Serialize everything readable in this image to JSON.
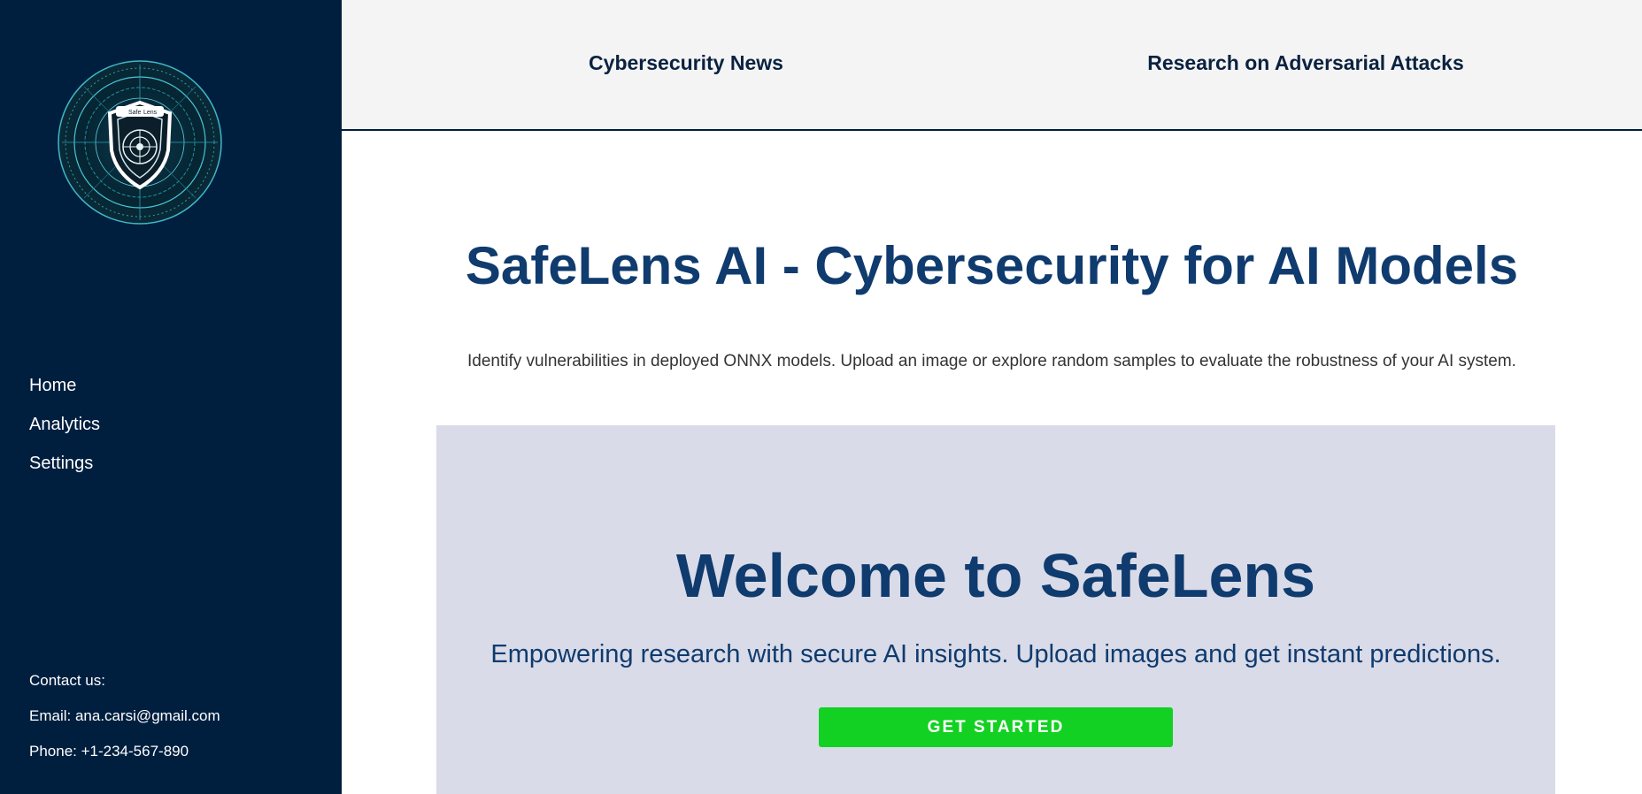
{
  "sidebar": {
    "logo": {
      "text_left": "Safe",
      "text_right": "Lens"
    },
    "nav": [
      {
        "label": "Home"
      },
      {
        "label": "Analytics"
      },
      {
        "label": "Settings"
      }
    ],
    "contact": {
      "heading": "Contact us:",
      "email": "Email: ana.carsi@gmail.com",
      "phone": "Phone: +1-234-567-890"
    }
  },
  "topbar": {
    "links": [
      {
        "label": "Cybersecurity News"
      },
      {
        "label": "Research on Adversarial Attacks"
      }
    ]
  },
  "main": {
    "title": "SafeLens AI - Cybersecurity for AI Models",
    "intro": "Identify vulnerabilities in deployed ONNX models. Upload an image or explore random samples to evaluate the robustness of your AI system.",
    "hero": {
      "heading": "Welcome to SafeLens",
      "subheading": "Empowering research with secure AI insights. Upload images and get instant predictions.",
      "cta_label": "GET STARTED"
    }
  },
  "colors": {
    "sidebar_bg": "#001f3f",
    "title_blue": "#0f3b6e",
    "hero_bg": "#d9dbe8",
    "cta_green": "#12d122"
  }
}
